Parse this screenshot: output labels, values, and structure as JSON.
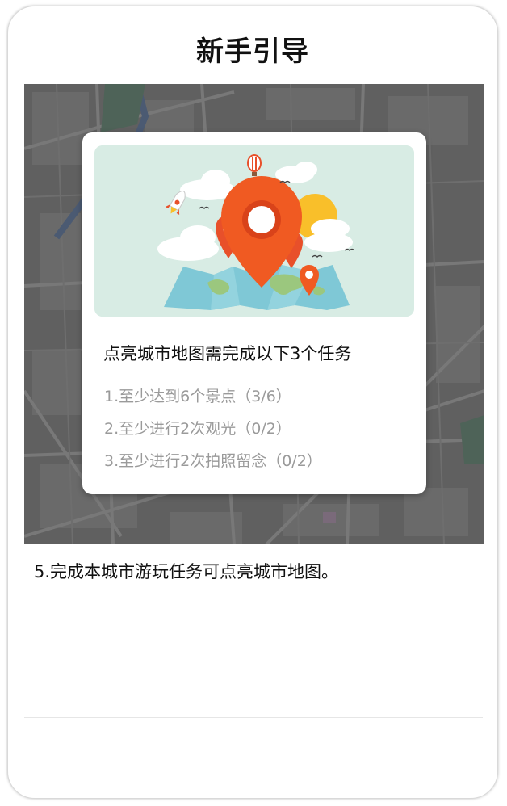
{
  "title": "新手引导",
  "card": {
    "heading": "点亮城市地图需完成以下3个任务",
    "tasks": [
      "1.至少达到6个景点（3/6）",
      "2.至少进行2次观光（0/2）",
      "3.至少进行2次拍照留念（0/2）"
    ]
  },
  "description": "5.完成本城市游玩任务可点亮城市地图。",
  "colors": {
    "pin": "#f05a22",
    "map_overlay": "#5f5f5f",
    "illustration_bg": "#d8ece4",
    "task_text": "#9a9a9a"
  },
  "icons": [
    "map-pin-icon",
    "rocket-icon",
    "hot-air-balloon-icon",
    "sun-icon",
    "cloud-icon",
    "world-map-icon"
  ]
}
